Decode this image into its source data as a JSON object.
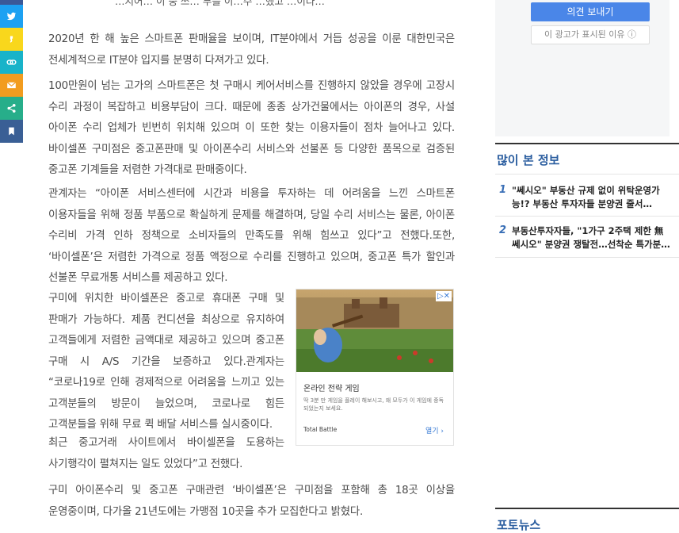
{
  "share_bar": {
    "items": [
      {
        "icon": "facebook-icon",
        "color": "#3b5998"
      },
      {
        "icon": "twitter-icon",
        "color": "#1da1f2"
      },
      {
        "icon": "kakaostory-icon",
        "color": "#f9d71c"
      },
      {
        "icon": "link-icon",
        "color": "#18b3c9"
      },
      {
        "icon": "mail-icon",
        "color": "#f29c1f"
      },
      {
        "icon": "share-icon",
        "color": "#27ae8a"
      },
      {
        "icon": "bookmark-icon",
        "color": "#3a5f95"
      }
    ]
  },
  "article": {
    "cut_line": "…지어… 이 중 쓰… 부를 이…수 …했고 …이다…",
    "paragraphs": [
      "2020년 한 해 높은 스마트폰 판매율을 보이며, IT분야에서 거듭 성공을 이룬 대한민국은 전세계적으로 IT분야 입지를 분명히 다져가고 있다.",
      "100만원이 넘는 고가의 스마트폰은 첫 구매시 케어서비스를 진행하지 않았을 경우에 고장시 수리 과정이 복잡하고 비용부담이 크다. 때문에 종종 상가건물에서는 아이폰의 경우, 사설 아이폰 수리 업체가 빈번히 위치해 있으며 이 또한 찾는 이용자들이 점차 늘어나고 있다.바이셀폰 구미점은 중고폰판매 및 아이폰수리 서비스와 선불폰 등 다양한 품목으로 검증된 중고폰 기계들을 저렴한 가격대로 판매중이다.",
      "관계자는 “아이폰 서비스센터에 시간과 비용을 투자하는 데 어려움을 느낀 스마트폰 이용자들을 위해 정품 부품으로 확실하게 문제를 해결하며, 당일 수리 서비스는 물론, 아이폰 수리비 가격 인하 정책으로 소비자들의 만족도를 위해 힘쓰고 있다”고 전했다.또한, ‘바이셀폰’은 저렴한 가격으로 정품 액정으로 수리를 진행하고 있으며, 중고폰 특가 할인과 선불폰 무료개통 서비스를 제공하고 있다.",
      "구미에 위치한 바이셀폰은 중고로 휴대폰 구매 및 판매가 가능하다. 제품 컨디션을 최상으로 유지하여 고객들에게 저렴한 금액대로 제공하고 있으며 중고폰 구매 시 A/S 기간을 보증하고 있다.관계자는 “코로나19로 인해 경제적으로 어려움을 느끼고 있는 고객분들의 방문이 늘었으며, 코로나로 힘든 고객분들을 위해 무료 퀵 배달 서비스를 실시중이다.",
      "최근 중고거래 사이트에서 바이셀폰을 도용하는 사기행각이 펼쳐지는 일도 있었다”고 전했다.",
      "구미 아이폰수리 및 중고폰 구매관련 ‘바이셀폰’은 구미점을 포함해 총 18곳 이상을 운영중이며, 다가올 21년도에는 가맹점 10곳을 추가 모집한다고 밝혔다."
    ]
  },
  "inline_ad": {
    "title": "온라인 전략 게임",
    "description": "딱 3분 만 게임을 플레이 해보시고, 왜 모두가 이 게임에 중독 되었는지 보세요.",
    "brand": "Total Battle",
    "cta": "열기 ›",
    "close_label": "▷✕"
  },
  "sidebar": {
    "ad_feedback_label": "의견 보내기",
    "ad_why_label": "이 광고가 표시된 이유 ⓘ",
    "popular_title": "많이 본 정보",
    "popular_items": [
      {
        "rank": "1",
        "line1": "\"쎄시오\" 부동산 규제 없이 위탁운영가",
        "line2": "능!? 부동산 투자자들 분양권 줄서…"
      },
      {
        "rank": "2",
        "line1": "부동산투자자들, \"1가구 2주택 제한 無",
        "line2": "쎄시오\" 분양권 쟁탈전…선착순 특가분…"
      }
    ],
    "photo_news_title": "포토뉴스"
  }
}
